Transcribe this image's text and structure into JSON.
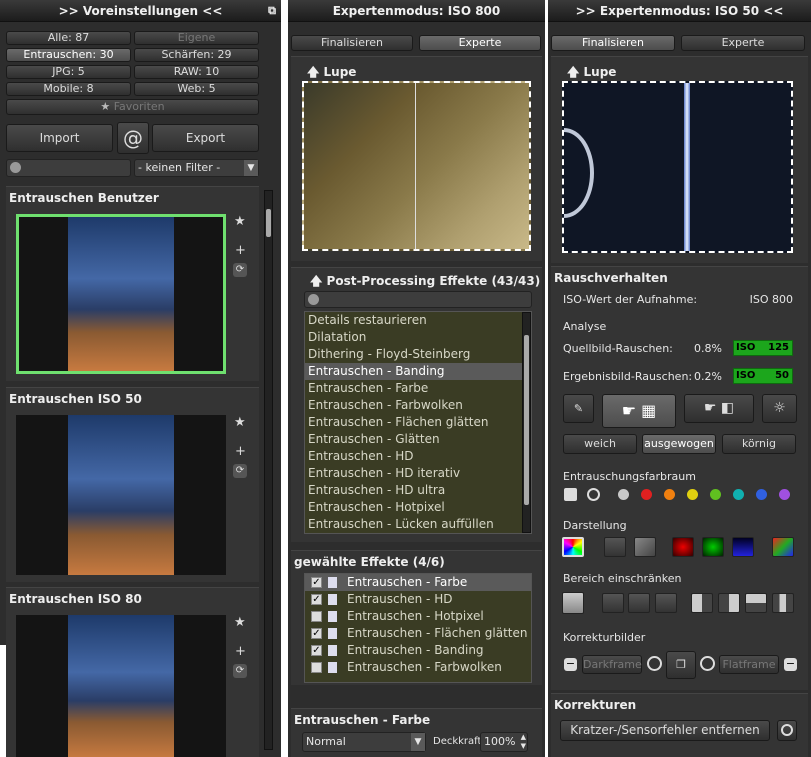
{
  "left": {
    "title": ">> Voreinstellungen <<",
    "filters": [
      {
        "label": "Alle: 87"
      },
      {
        "label": "Eigene"
      },
      {
        "label": "Entrauschen: 30"
      },
      {
        "label": "Schärfen: 29"
      },
      {
        "label": "JPG: 5"
      },
      {
        "label": "RAW: 10"
      },
      {
        "label": "Mobile: 8"
      },
      {
        "label": "Web: 5"
      }
    ],
    "favorites": "Favoriten",
    "import": "Import",
    "export": "Export",
    "at_icon": "@",
    "filter_select": "- keinen Filter -",
    "presets": [
      {
        "title": "Entrauschen Benutzer"
      },
      {
        "title": "Entrauschen ISO 50"
      },
      {
        "title": "Entrauschen ISO 80"
      }
    ]
  },
  "middle": {
    "title": "Expertenmodus: ISO 800",
    "tab_finalize": "Finalisieren",
    "tab_expert": "Experte",
    "loupe": "Lupe",
    "post_title": "Post-Processing Effekte (43/43)",
    "effects": [
      "Details restaurieren",
      "Dilatation",
      "Dithering - Floyd-Steinberg",
      "Entrauschen - Banding",
      "Entrauschen - Farbe",
      "Entrauschen - Farbwolken",
      "Entrauschen - Flächen glätten",
      "Entrauschen - Glätten",
      "Entrauschen - HD",
      "Entrauschen - HD iterativ",
      "Entrauschen - HD ultra",
      "Entrauschen - Hotpixel",
      "Entrauschen - Lücken auffüllen"
    ],
    "selected_title": "gewählte Effekte (4/6)",
    "selected": [
      {
        "label": "Entrauschen - Farbe",
        "checked": "✓"
      },
      {
        "label": "Entrauschen - HD",
        "checked": "✓"
      },
      {
        "label": "Entrauschen - Hotpixel",
        "checked": ""
      },
      {
        "label": "Entrauschen - Flächen glätten",
        "checked": "✓"
      },
      {
        "label": "Entrauschen - Banding",
        "checked": "✓"
      },
      {
        "label": "Entrauschen - Farbwolken",
        "checked": ""
      }
    ],
    "effect_title": "Entrauschen - Farbe",
    "blend_mode": "Normal",
    "opacity_label": "Deckkraft",
    "opacity_value": "100%"
  },
  "right": {
    "title": ">> Expertenmodus: ISO 50 <<",
    "tab_finalize": "Finalisieren",
    "tab_expert": "Experte",
    "loupe": "Lupe",
    "noise_title": "Rauschverhalten",
    "iso_label": "ISO-Wert der Aufnahme:",
    "iso_value": "ISO 800",
    "analysis": "Analyse",
    "source_noise_label": "Quellbild-Rauschen:",
    "source_noise_value": "0.8%",
    "source_badge_iso": "ISO",
    "source_badge_val": "125",
    "result_noise_label": "Ergebnisbild-Rauschen:",
    "result_noise_value": "0.2%",
    "result_badge_iso": "ISO",
    "result_badge_val": "50",
    "mode_soft": "weich",
    "mode_balanced": "ausgewogen",
    "mode_grainy": "körnig",
    "colorspace_label": "Entrauschungsfarbraum",
    "display_label": "Darstellung",
    "restrict_label": "Bereich einschränken",
    "correction_label": "Korrekturbilder",
    "darkframe": "Darkframe",
    "flatframe": "Flatframe",
    "corrections_title": "Korrekturen",
    "sensor_button": "Kratzer-/Sensorfehler entfernen",
    "dot_colors": [
      "#c8c8c8",
      "#e02020",
      "#f08010",
      "#e0d010",
      "#60c020",
      "#10b0b0",
      "#3060e0",
      "#a050e0"
    ]
  }
}
